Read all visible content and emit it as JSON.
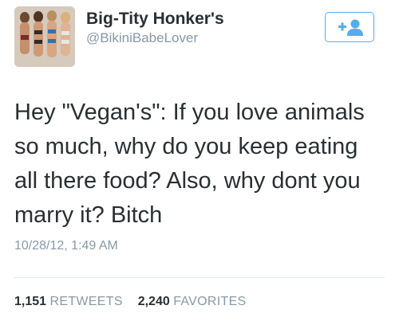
{
  "user": {
    "display_name": "Big-Tity Honker's",
    "screen_name": "@BikiniBabeLover",
    "avatar_icon": "avatar-photo"
  },
  "follow_button": {
    "icon": "follow-user-icon",
    "color": "#55acee"
  },
  "tweet": {
    "lines": [
      "Hey \"Vegan's\": If you love animals",
      "so much, why do you keep eating",
      "all there food? Also, why dont you",
      "marry it? Bitch"
    ],
    "timestamp": "10/28/12, 1:49 AM"
  },
  "stats": {
    "retweets_count": "1,151",
    "retweets_label": "RETWEETS",
    "favorites_count": "2,240",
    "favorites_label": "FAVORITES"
  }
}
